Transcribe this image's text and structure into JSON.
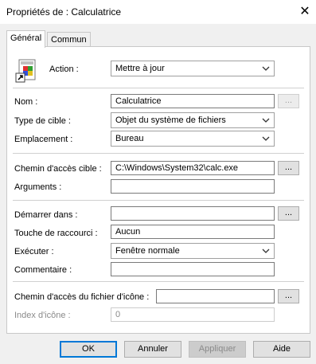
{
  "window": {
    "title": "Propriétés de : Calculatrice",
    "close_glyph": "✕"
  },
  "tabs": [
    {
      "label": "Général"
    },
    {
      "label": "Commun"
    }
  ],
  "form": {
    "action": {
      "label": "Action :",
      "value": "Mettre à jour"
    },
    "nom": {
      "label": "Nom :",
      "value": "Calculatrice",
      "browse": "..."
    },
    "type_cible": {
      "label": "Type de cible :",
      "value": "Objet du système de fichiers"
    },
    "emplacement": {
      "label": "Emplacement :",
      "value": "Bureau"
    },
    "chemin_cible": {
      "label": "Chemin d'accès cible :",
      "value": "C:\\Windows\\System32\\calc.exe",
      "browse": "..."
    },
    "arguments": {
      "label": "Arguments :",
      "value": ""
    },
    "demarrer_dans": {
      "label": "Démarrer dans :",
      "value": "",
      "browse": "..."
    },
    "touche_raccourci": {
      "label": "Touche de raccourci :",
      "value": "Aucun"
    },
    "executer": {
      "label": "Exécuter :",
      "value": "Fenêtre normale"
    },
    "commentaire": {
      "label": "Commentaire :",
      "value": ""
    },
    "chemin_icone": {
      "label": "Chemin d'accès du fichier d'icône :",
      "value": "",
      "browse": "..."
    },
    "index_icone": {
      "label": "Index d'icône :",
      "value": "0"
    }
  },
  "buttons": {
    "ok": "OK",
    "cancel": "Annuler",
    "apply": "Appliquer",
    "help": "Aide"
  },
  "colors": {
    "accent": "#0078d7",
    "dialog_bg": "#f0f0f0"
  }
}
